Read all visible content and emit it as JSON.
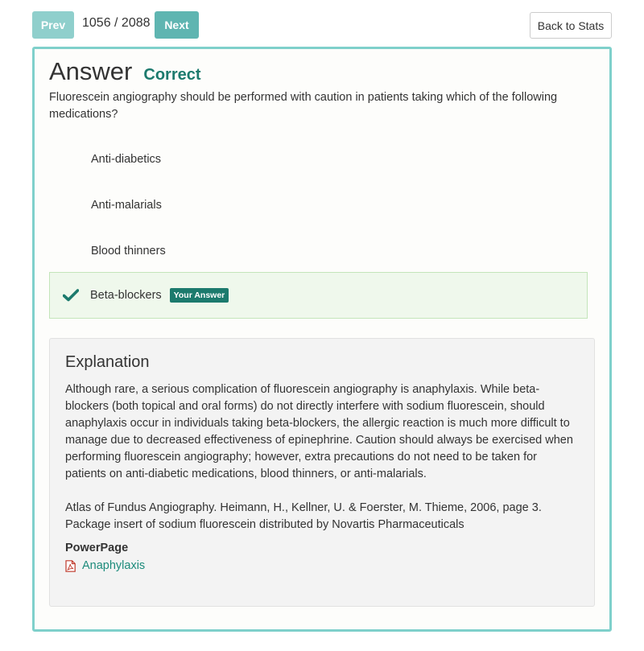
{
  "nav": {
    "prev_label": "Prev",
    "next_label": "Next",
    "counter": "1056 / 2088",
    "back_label": "Back to Stats"
  },
  "answer": {
    "heading": "Answer",
    "status": "Correct",
    "question": "Fluorescein angiography should be performed with caution in patients taking which of the following medications?",
    "options": [
      {
        "text": "Anti-diabetics"
      },
      {
        "text": "Anti-malarials"
      },
      {
        "text": "Blood thinners"
      },
      {
        "text": "Beta-blockers",
        "badge": "Your Answer",
        "icon": "checkmark-icon"
      }
    ]
  },
  "explanation": {
    "heading": "Explanation",
    "body": "Although rare, a serious complication of fluorescein angiography is anaphylaxis. While beta-blockers (both topical and oral forms) do not directly interfere with sodium fluorescein, should anaphylaxis occur in individuals taking beta-blockers, the allergic reaction is much more difficult to manage due to decreased effectiveness of epinephrine. Caution should always be exercised when performing fluorescein angiography; however, extra precautions do not need to be taken for patients on anti-diabetic medications, blood thinners, or anti-malarials.",
    "references": [
      "Atlas of Fundus Angiography. Heimann, H., Kellner, U. & Foerster, M. Thieme, 2006, page 3.",
      "Package insert of sodium fluorescein distributed by Novartis Pharmaceuticals"
    ],
    "powerpage_label": "PowerPage",
    "powerpage_link": "Anaphylaxis",
    "link_icon": "pdf-icon"
  },
  "colors": {
    "accent": "#1c7a6d",
    "card_border": "#7fd0cb",
    "prev_button": "#8fcfcc",
    "next_button": "#5fb5b1",
    "selected_bg": "#eff8ec",
    "pdf_icon": "#c0392b"
  }
}
